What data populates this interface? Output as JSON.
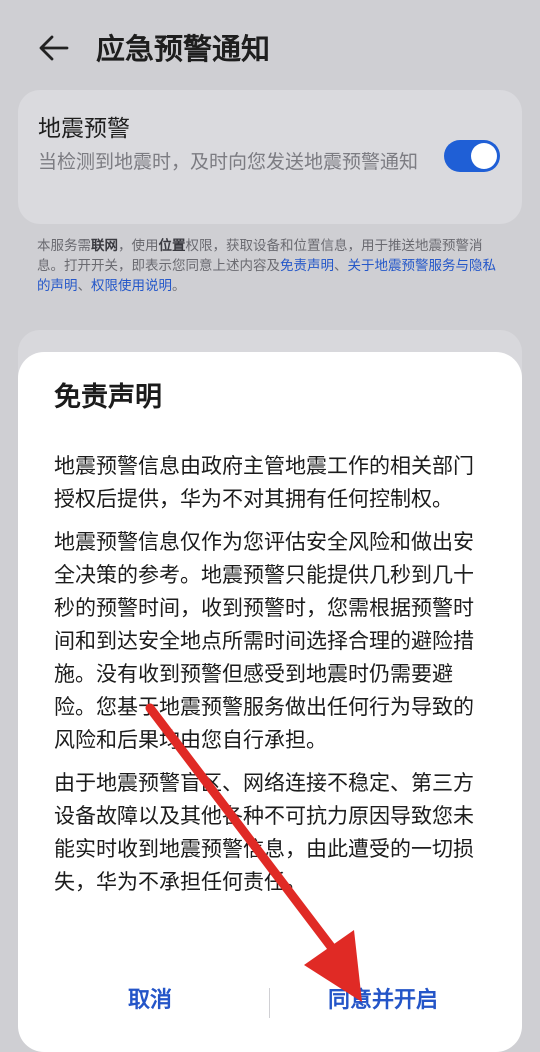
{
  "header": {
    "title": "应急预警通知",
    "back_icon": "arrow-left-icon"
  },
  "setting": {
    "title": "地震预警",
    "description": "当检测到地震时，及时向您发送地震预警通知",
    "toggle_on": true,
    "toggle_color": "#1f5fd6"
  },
  "notice": {
    "p1": "本服务需",
    "network": "联网",
    "p2": "，使用",
    "location": "位置",
    "p3": "权限，获取设备和位置信息，用于推送地震预警消息。打开开关，即表示您同意上述内容及",
    "link1": "免责声明",
    "sep1": "、",
    "link2": "关于地震预警服务与隐私的声明",
    "sep2": "、",
    "link3": "权限使用说明",
    "end": "。"
  },
  "dialog": {
    "title": "免责声明",
    "paragraphs": [
      "地震预警信息由政府主管地震工作的相关部门授权后提供，华为不对其拥有任何控制权。",
      "地震预警信息仅作为您评估安全风险和做出安全决策的参考。地震预警只能提供几秒到几十秒的预警时间，收到预警时，您需根据预警时间和到达安全地点所需时间选择合理的避险措施。没有收到预警但感受到地震时仍需要避险。您基于地震预警服务做出任何行为导致的风险和后果均由您自行承担。",
      "由于地震预警盲区、网络连接不稳定、第三方设备故障以及其他各种不可抗力原因导致您未能实时收到地震预警信息，由此遭受的一切损失，华为不承担任何责任。"
    ],
    "cancel_label": "取消",
    "agree_label": "同意并开启",
    "accent_color": "#2455c8"
  },
  "overlay": {
    "arrow_color": "#e02a25"
  }
}
